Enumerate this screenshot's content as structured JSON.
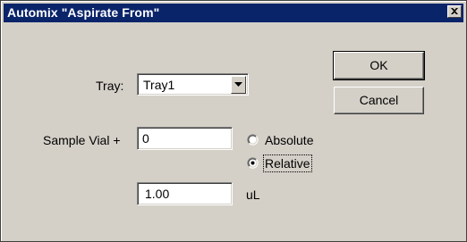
{
  "window": {
    "title": "Automix \"Aspirate From\""
  },
  "tray": {
    "label": "Tray:",
    "selected": "Tray1"
  },
  "sample_vial": {
    "label": "Sample Vial +",
    "value": "0"
  },
  "mode": {
    "options": [
      "Absolute",
      "Relative"
    ],
    "selected": "Relative"
  },
  "volume": {
    "value": "1.00",
    "unit": "uL"
  },
  "buttons": {
    "ok": "OK",
    "cancel": "Cancel"
  },
  "icons": {
    "close": "close-icon",
    "dropdown": "chevron-down-icon"
  }
}
